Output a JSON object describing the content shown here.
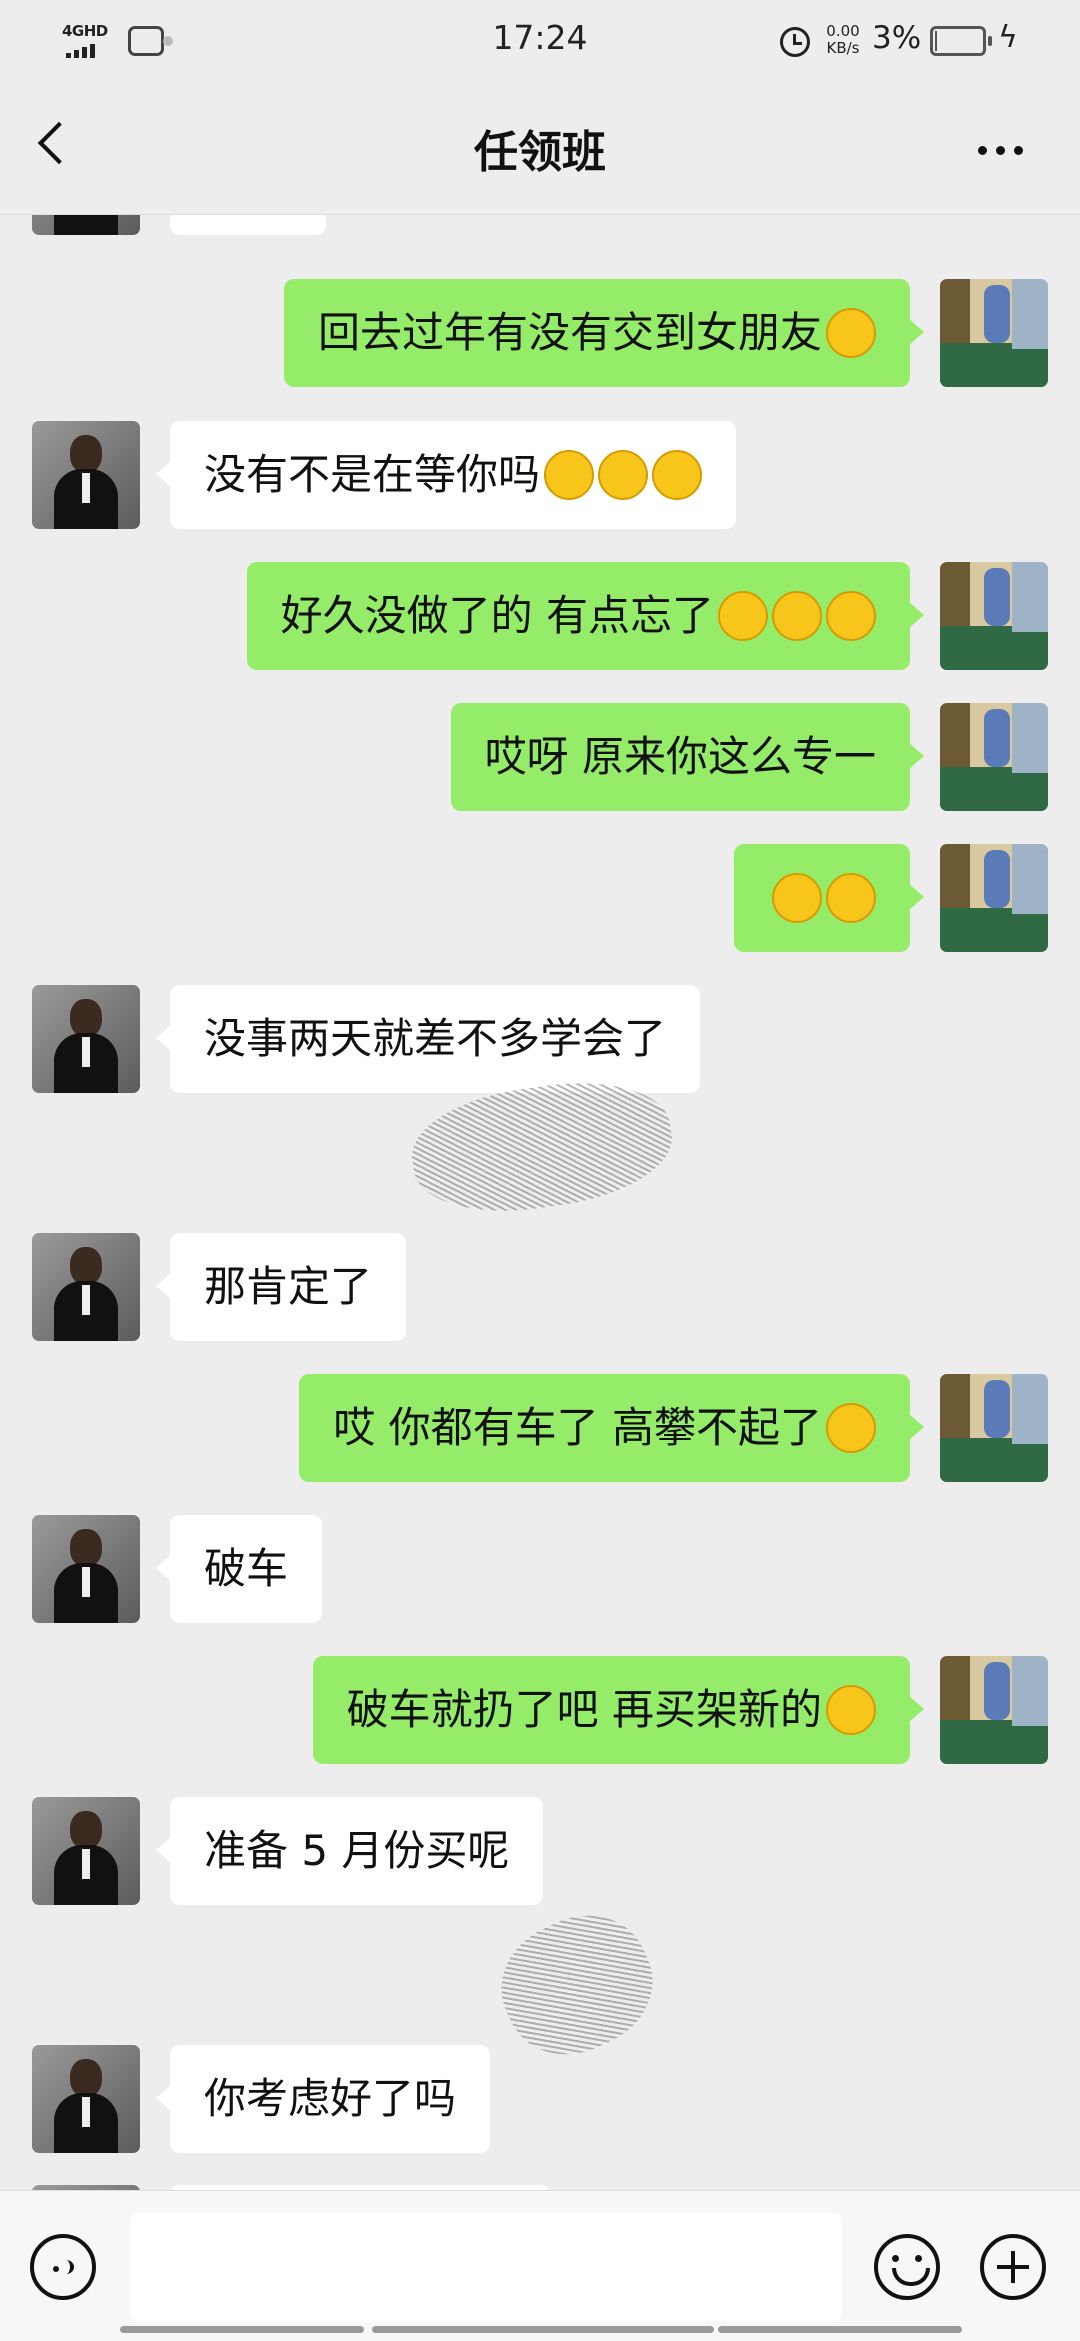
{
  "status_bar": {
    "network": "4GHD",
    "time": "17:24",
    "speed_value": "0.00",
    "speed_unit": "KB/s",
    "battery_percent": "3%",
    "battery_level": 0.03,
    "icons": [
      "signal-icon",
      "app-notification-icon",
      "alarm-icon",
      "battery-icon",
      "charging-icon"
    ]
  },
  "header": {
    "title": "任领班",
    "back_icon": "chevron-left-icon",
    "more_icon": "more-dots-icon"
  },
  "messages": [
    {
      "from": "friend",
      "text": "…"
    },
    {
      "from": "me",
      "text": "回去过年有没有交到女朋友",
      "emoji": [
        "grinning"
      ]
    },
    {
      "from": "friend",
      "text": "没有不是在等你吗",
      "emoji": [
        "hand-over-mouth",
        "hand-over-mouth",
        "hand-over-mouth"
      ]
    },
    {
      "from": "me",
      "text": "好久没做了的  有点忘了",
      "emoji": [
        "shushing",
        "shushing",
        "shushing"
      ]
    },
    {
      "from": "me",
      "text": "哎呀  原来你这么专一"
    },
    {
      "from": "me",
      "text": "",
      "emoji": [
        "tears-of-joy",
        "tears-of-joy"
      ]
    },
    {
      "from": "friend",
      "text": "没事两天就差不多学会了"
    },
    {
      "from": "friend",
      "text": "那肯定了"
    },
    {
      "from": "me",
      "text": "哎  你都有车了  高攀不起了",
      "emoji": [
        "tears-of-joy"
      ]
    },
    {
      "from": "friend",
      "text": "破车"
    },
    {
      "from": "me",
      "text": "破车就扔了吧  再买架新的",
      "emoji": [
        "hand-over-mouth"
      ]
    },
    {
      "from": "friend",
      "text": "准备 5 月份买呢"
    },
    {
      "from": "friend",
      "text": "你考虑好了吗"
    }
  ],
  "input_bar": {
    "voice_icon": "voice-icon",
    "emoji_icon": "emoji-icon",
    "plus_icon": "plus-icon",
    "text": ""
  },
  "colors": {
    "background": "#ededed",
    "my_bubble": "#95ec69",
    "friend_bubble": "#ffffff"
  }
}
